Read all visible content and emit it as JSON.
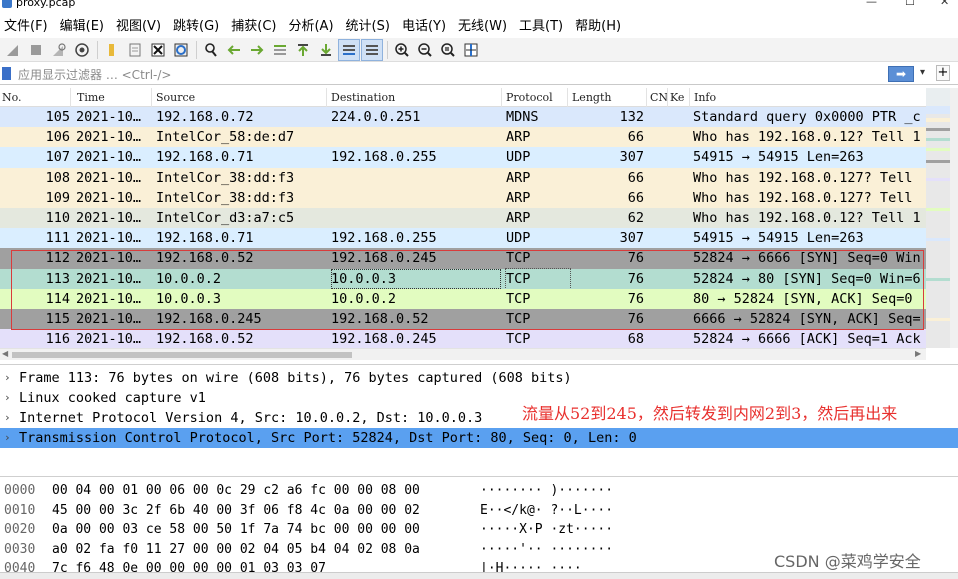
{
  "window": {
    "title": "proxy.pcap"
  },
  "menu": [
    "文件(F)",
    "编辑(E)",
    "视图(V)",
    "跳转(G)",
    "捕获(C)",
    "分析(A)",
    "统计(S)",
    "电话(Y)",
    "无线(W)",
    "工具(T)",
    "帮助(H)"
  ],
  "filter": {
    "placeholder": "应用显示过滤器 … <Ctrl-/>",
    "apply_arrow": "➡",
    "add_button": "+"
  },
  "columns": [
    "No.",
    "Time",
    "Source",
    "Destination",
    "Protocol",
    "Length",
    "CN",
    "Ke",
    "Info"
  ],
  "packets": [
    {
      "no": "105",
      "time": "2021-10…",
      "src": "192.168.0.72",
      "dst": "224.0.0.251",
      "proto": "MDNS",
      "len": "132",
      "info": "Standard query 0x0000 PTR _c",
      "bg": "#dae8fc"
    },
    {
      "no": "106",
      "time": "2021-10…",
      "src": "IntelCor_58:de:d7",
      "dst": "",
      "proto": "ARP",
      "len": "66",
      "info": "Who has 192.168.0.12? Tell 1",
      "bg": "#faf0d7"
    },
    {
      "no": "107",
      "time": "2021-10…",
      "src": "192.168.0.71",
      "dst": "192.168.0.255",
      "proto": "UDP",
      "len": "307",
      "info": "54915 → 54915 Len=263",
      "bg": "#daeeff"
    },
    {
      "no": "108",
      "time": "2021-10…",
      "src": "IntelCor_38:dd:f3",
      "dst": "",
      "proto": "ARP",
      "len": "66",
      "info": "Who has 192.168.0.127? Tell",
      "bg": "#faf0d7"
    },
    {
      "no": "109",
      "time": "2021-10…",
      "src": "IntelCor_38:dd:f3",
      "dst": "",
      "proto": "ARP",
      "len": "66",
      "info": "Who has 192.168.0.127? Tell",
      "bg": "#faf0d7"
    },
    {
      "no": "110",
      "time": "2021-10…",
      "src": "IntelCor_d3:a7:c5",
      "dst": "",
      "proto": "ARP",
      "len": "62",
      "info": "Who has 192.168.0.12? Tell 1",
      "bg": "#e4e8de"
    },
    {
      "no": "111",
      "time": "2021-10…",
      "src": "192.168.0.71",
      "dst": "192.168.0.255",
      "proto": "UDP",
      "len": "307",
      "info": "54915 → 54915 Len=263",
      "bg": "#daeeff"
    },
    {
      "no": "112",
      "time": "2021-10…",
      "src": "192.168.0.52",
      "dst": "192.168.0.245",
      "proto": "TCP",
      "len": "76",
      "info": "52824 → 6666 [SYN] Seq=0 Win",
      "bg": "#a0a0a0"
    },
    {
      "no": "113",
      "time": "2021-10…",
      "src": "10.0.0.2",
      "dst": "10.0.0.3",
      "proto": "TCP",
      "len": "76",
      "info": "52824 → 80 [SYN] Seq=0 Win=6",
      "bg": "#b3ddd0"
    },
    {
      "no": "114",
      "time": "2021-10…",
      "src": "10.0.0.3",
      "dst": "10.0.0.2",
      "proto": "TCP",
      "len": "76",
      "info": "80 → 52824 [SYN, ACK] Seq=0",
      "bg": "#e2fcc0"
    },
    {
      "no": "115",
      "time": "2021-10…",
      "src": "192.168.0.245",
      "dst": "192.168.0.52",
      "proto": "TCP",
      "len": "76",
      "info": "6666 → 52824 [SYN, ACK] Seq=",
      "bg": "#a0a0a0"
    },
    {
      "no": "116",
      "time": "2021-10…",
      "src": "192.168.0.52",
      "dst": "192.168.0.245",
      "proto": "TCP",
      "len": "68",
      "info": "52824 → 6666 [ACK] Seq=1 Ack",
      "bg": "#e4e0fa"
    }
  ],
  "details": [
    "Frame 113: 76 bytes on wire (608 bits), 76 bytes captured (608 bits)",
    "Linux cooked capture v1",
    "Internet Protocol Version 4, Src: 10.0.0.2, Dst: 10.0.0.3",
    "Transmission Control Protocol, Src Port: 52824, Dst Port: 80, Seq: 0, Len: 0"
  ],
  "annotation": "流量从52到245，然后转发到内网2到3，然后再出来",
  "bytes": [
    {
      "off": "0000",
      "hex": "00 04 00 01 00 06 00 0c  29 c2 a6 fc 00 00 08 00",
      "ascii": "········ )·······"
    },
    {
      "off": "0010",
      "hex": "45 00 00 3c 2f 6b 40 00  3f 06 f8 4c 0a 00 00 02",
      "ascii": "E··</k@· ?··L····"
    },
    {
      "off": "0020",
      "hex": "0a 00 00 03 ce 58 00 50  1f 7a 74 bc 00 00 00 00",
      "ascii": "·····X·P ·zt·····"
    },
    {
      "off": "0030",
      "hex": "a0 02 fa f0 11 27 00 00  02 04 05 b4 04 02 08 0a",
      "ascii": "·····'·· ········"
    },
    {
      "off": "0040",
      "hex": "7c f6 48 0e 00 00 00 00  01 03 03 07",
      "ascii": "|·H····· ····"
    }
  ],
  "watermark": "CSDN @菜鸡学安全"
}
